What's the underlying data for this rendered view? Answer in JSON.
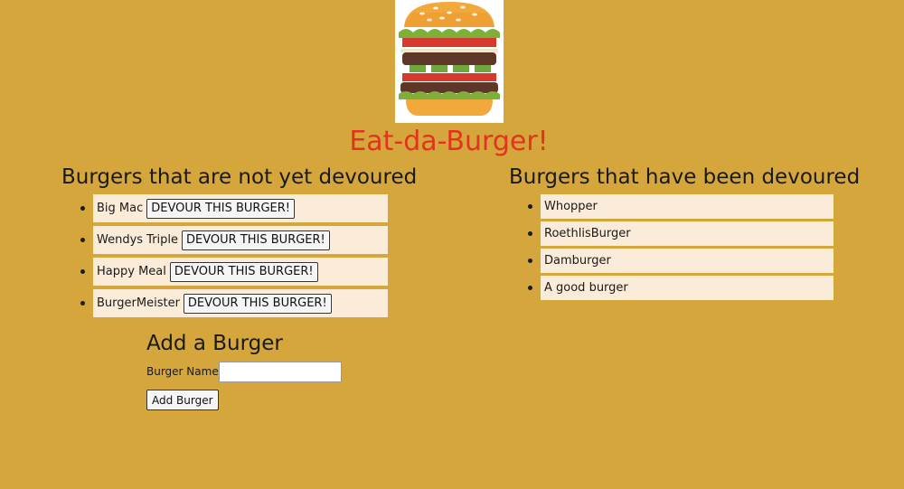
{
  "header": {
    "logo_icon": "burger-icon",
    "title": "Eat-da-Burger!"
  },
  "not_devoured": {
    "heading": "Burgers that are not yet devoured",
    "items": [
      {
        "name": "Big Mac",
        "button": "DEVOUR THIS BURGER!"
      },
      {
        "name": "Wendys Triple",
        "button": "DEVOUR THIS BURGER!"
      },
      {
        "name": "Happy Meal",
        "button": "DEVOUR THIS BURGER!"
      },
      {
        "name": "BurgerMeister",
        "button": "DEVOUR THIS BURGER!"
      }
    ]
  },
  "devoured": {
    "heading": "Burgers that have been devoured",
    "items": [
      {
        "name": "Whopper"
      },
      {
        "name": "RoethlisBurger"
      },
      {
        "name": "Damburger"
      },
      {
        "name": "A good burger"
      }
    ]
  },
  "add_form": {
    "heading": "Add a Burger",
    "name_label": "Burger Name:",
    "name_value": "",
    "name_placeholder": "",
    "submit_label": "Add Burger"
  },
  "colors": {
    "background": "#D4A63C",
    "title": "#E3331C",
    "list_item_bg": "#FBEBD9"
  }
}
